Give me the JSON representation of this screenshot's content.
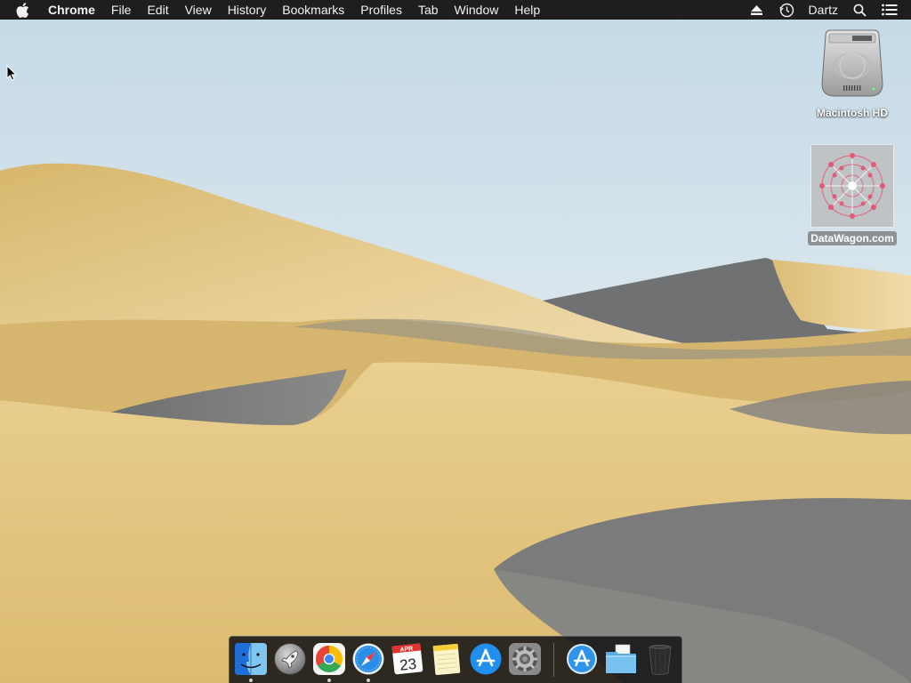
{
  "menubar": {
    "apple_icon": "apple-logo-icon",
    "app_name": "Chrome",
    "items": [
      "File",
      "Edit",
      "View",
      "History",
      "Bookmarks",
      "Profiles",
      "Tab",
      "Window",
      "Help"
    ],
    "right": {
      "eject_icon": "eject-icon",
      "clock_icon": "time-machine-icon",
      "user_name": "Dartz",
      "search_icon": "spotlight-search-icon",
      "notifications_icon": "notification-center-icon"
    }
  },
  "desktop": {
    "icons": [
      {
        "label": "Macintosh HD",
        "icon": "hard-drive-icon"
      },
      {
        "label": "DataWagon.com",
        "icon": "image-file-icon"
      }
    ]
  },
  "dock": {
    "items": [
      {
        "name": "Finder",
        "icon": "finder-icon",
        "running": true
      },
      {
        "name": "Launchpad",
        "icon": "launchpad-icon",
        "running": false
      },
      {
        "name": "Google Chrome",
        "icon": "chrome-icon",
        "running": true
      },
      {
        "name": "Safari",
        "icon": "safari-icon",
        "running": true
      },
      {
        "name": "Calendar",
        "icon": "calendar-icon",
        "running": false,
        "month": "APR",
        "day": "23"
      },
      {
        "name": "Notes",
        "icon": "notes-icon",
        "running": false
      },
      {
        "name": "App Store",
        "icon": "app-store-icon",
        "running": false
      },
      {
        "name": "System Preferences",
        "icon": "system-preferences-icon",
        "running": false
      },
      {
        "name": "Applications",
        "icon": "applications-folder-icon",
        "running": false
      },
      {
        "name": "Documents",
        "icon": "documents-folder-icon",
        "running": false
      },
      {
        "name": "Trash",
        "icon": "trash-icon",
        "running": false
      }
    ]
  },
  "colors": {
    "menubar_bg": "#1e1e1e",
    "sky_top": "#c9dde9",
    "sand_light": "#e8cf95",
    "sand_shadow": "#7d7f80"
  }
}
